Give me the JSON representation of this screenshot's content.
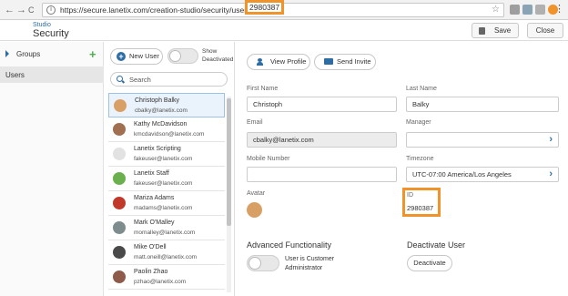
{
  "browser": {
    "back": "←",
    "forward": "→",
    "reload": "C",
    "url_prefix": "https://secure.lanetix.com/creation-studio/security/user",
    "url_highlight": "2980387",
    "star": "☆",
    "menu": "⋮"
  },
  "header": {
    "supertitle": "Studio",
    "title": "Security",
    "save_label": "Save",
    "close_label": "Close"
  },
  "leftnav": {
    "groups_label": "Groups",
    "add_symbol": "+",
    "users_label": "Users"
  },
  "userlist": {
    "new_user_label": "New User",
    "show_deactivated_label_1": "Show",
    "show_deactivated_label_2": "Deactivated",
    "search_placeholder": "Search",
    "users": [
      {
        "name": "Christoph Balky",
        "email": "cbalky@lanetix.com",
        "selected": true,
        "avatar_color": "#d9a066"
      },
      {
        "name": "Kathy McDavidson",
        "email": "kmcdavidson@lanetix.com",
        "selected": false,
        "avatar_color": "#a07050"
      },
      {
        "name": "Lanetix Scripting",
        "email": "fakeuser@lanetix.com",
        "selected": false,
        "avatar_color": "#e2e2e2"
      },
      {
        "name": "Lanetix Staff",
        "email": "fakeuser@lanetix.com",
        "selected": false,
        "avatar_color": "#6ab04c"
      },
      {
        "name": "Mariza Adams",
        "email": "madams@lanetix.com",
        "selected": false,
        "avatar_color": "#c0392b"
      },
      {
        "name": "Mark O'Malley",
        "email": "momalley@lanetix.com",
        "selected": false,
        "avatar_color": "#7f8c8d"
      },
      {
        "name": "Mike O'Dell",
        "email": "matt.oneill@lanetix.com",
        "selected": false,
        "avatar_color": "#4a4a4a"
      },
      {
        "name": "Paolin Zhao",
        "email": "pzhao@lanetix.com",
        "selected": false,
        "avatar_color": "#8e5a4a"
      }
    ]
  },
  "detail": {
    "view_profile_label": "View Profile",
    "send_invite_label": "Send Invite",
    "first_name_label": "First Name",
    "first_name_value": "Christoph",
    "last_name_label": "Last Name",
    "last_name_value": "Balky",
    "email_label": "Email",
    "email_value": "cbalky@lanetix.com",
    "manager_label": "Manager",
    "manager_value": "",
    "mobile_label": "Mobile Number",
    "mobile_value": "",
    "timezone_label": "Timezone",
    "timezone_value": "UTC-07:00 America/Los Angeles",
    "avatar_label": "Avatar",
    "id_label": "ID",
    "id_value": "2980387",
    "advanced_title": "Advanced Functionality",
    "customer_admin_label_1": "User is Customer",
    "customer_admin_label_2": "Administrator",
    "deactivate_title": "Deactivate User",
    "deactivate_button": "Deactivate",
    "chevron": "›"
  },
  "colors": {
    "accent": "#2e6da4",
    "highlight": "#f0932b",
    "add_green": "#4caf50"
  }
}
